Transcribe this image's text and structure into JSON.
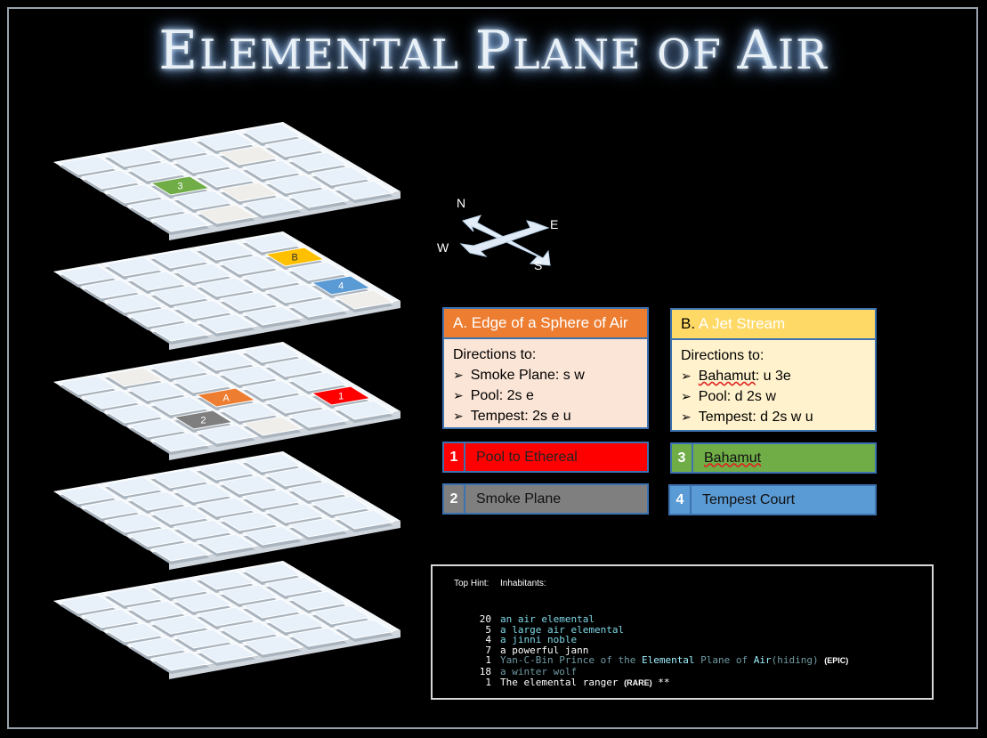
{
  "title": "Elemental Plane of Air",
  "title_parts": [
    "E",
    "LEMENTAL ",
    "P",
    "LANE OF ",
    "A",
    "IR"
  ],
  "compass": {
    "n": "N",
    "e": "E",
    "s": "S",
    "w": "W"
  },
  "colors": {
    "orange": "#ed7d31",
    "yellow": "#ffc000",
    "green": "#70ad47",
    "red": "#ff0000",
    "grey": "#7f7f7f",
    "blue": "#5b9bd5",
    "tile": "#e8f1fa",
    "tile_blank": "#f0eeea"
  },
  "levels": [
    {
      "name": "level-1",
      "marks": [
        {
          "label": "3",
          "color": "green"
        }
      ]
    },
    {
      "name": "level-2",
      "marks": [
        {
          "label": "B",
          "color": "yellow"
        },
        {
          "label": "4",
          "color": "blue"
        }
      ]
    },
    {
      "name": "level-3",
      "marks": [
        {
          "label": "A",
          "color": "orange"
        },
        {
          "label": "2",
          "color": "grey"
        },
        {
          "label": "1",
          "color": "red"
        }
      ]
    },
    {
      "name": "level-4",
      "marks": []
    },
    {
      "name": "level-5",
      "marks": []
    }
  ],
  "card_a": {
    "letter": "A.",
    "title": "Edge of a Sphere of Air",
    "intro": "Directions to:",
    "items": [
      "Smoke Plane: s w",
      "Pool: 2s e",
      "Tempest: 2s e u"
    ]
  },
  "card_b": {
    "letter": "B.",
    "title": "A Jet Stream",
    "intro": "Directions to:",
    "items": [
      {
        "name": "Bahamut",
        "rest": ": u 3e"
      },
      {
        "name": "Pool",
        "rest": ": d 2s w"
      },
      {
        "name": "Tempest",
        "rest": ": d 2s w u"
      }
    ]
  },
  "legend": [
    {
      "num": "1",
      "label": "Pool to Ethereal"
    },
    {
      "num": "2",
      "label": "Smoke Plane"
    },
    {
      "num": "3",
      "label": "Bahamut"
    },
    {
      "num": "4",
      "label": "Tempest Court"
    }
  ],
  "hint": {
    "top_hint": "Top Hint:",
    "inhabitants": "Inhabitants:",
    "rows": [
      {
        "count": "20",
        "text": "an air elemental"
      },
      {
        "count": "5",
        "text": "a large air elemental"
      },
      {
        "count": "4",
        "text": "a jinni noble"
      },
      {
        "count": "7",
        "text": "a powerful jann"
      },
      {
        "count": "1",
        "pre": "Yan-C-Bin Prince of the ",
        "hl1": "Elemental",
        "mid": " Plane of ",
        "hl2": "Air",
        "post": "(hiding)",
        "tag": "(EPIC)"
      },
      {
        "count": "18",
        "text": "a winter wolf"
      },
      {
        "count": "1",
        "text": "The elemental ranger",
        "tag": "(RARE)",
        "extra": " **"
      }
    ]
  }
}
